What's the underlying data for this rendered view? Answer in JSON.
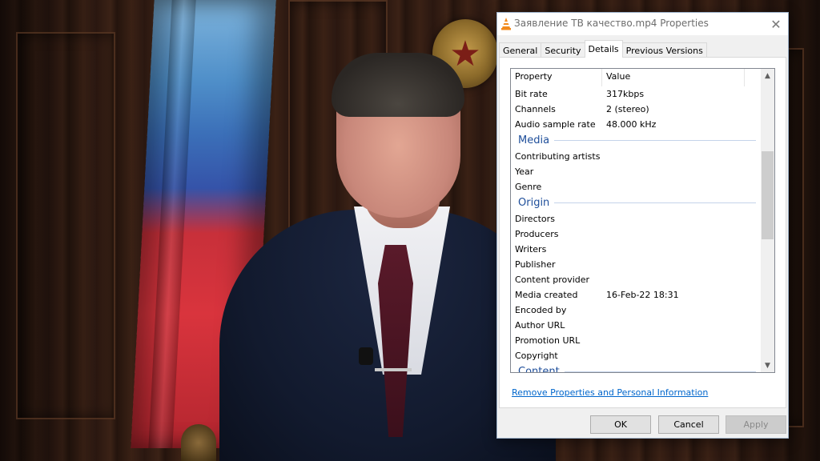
{
  "window": {
    "title": "Заявление ТВ качество.mp4 Properties",
    "icon": "vlc-cone-icon",
    "close_glyph": "✕"
  },
  "tabs": [
    {
      "label": "General",
      "active": false
    },
    {
      "label": "Security",
      "active": false
    },
    {
      "label": "Details",
      "active": true
    },
    {
      "label": "Previous Versions",
      "active": false
    }
  ],
  "details": {
    "columns": {
      "property": "Property",
      "value": "Value"
    },
    "top_rows": [
      {
        "name": "Bit rate",
        "value": "317kbps"
      },
      {
        "name": "Channels",
        "value": "2 (stereo)"
      },
      {
        "name": "Audio sample rate",
        "value": "48.000 kHz"
      }
    ],
    "groups": {
      "media": {
        "label": "Media",
        "rows": [
          {
            "name": "Contributing artists",
            "value": ""
          },
          {
            "name": "Year",
            "value": ""
          },
          {
            "name": "Genre",
            "value": ""
          }
        ]
      },
      "origin": {
        "label": "Origin",
        "rows": [
          {
            "name": "Directors",
            "value": ""
          },
          {
            "name": "Producers",
            "value": ""
          },
          {
            "name": "Writers",
            "value": ""
          },
          {
            "name": "Publisher",
            "value": ""
          },
          {
            "name": "Content provider",
            "value": ""
          },
          {
            "name": "Media created",
            "value": "16-Feb-22 18:31"
          },
          {
            "name": "Encoded by",
            "value": ""
          },
          {
            "name": "Author URL",
            "value": ""
          },
          {
            "name": "Promotion URL",
            "value": ""
          },
          {
            "name": "Copyright",
            "value": ""
          }
        ]
      }
    },
    "partial_group": {
      "label": "Content"
    }
  },
  "link": {
    "remove": "Remove Properties and Personal Information"
  },
  "buttons": {
    "ok": "OK",
    "cancel": "Cancel",
    "apply": "Apply"
  },
  "scroll": {
    "up_glyph": "▲",
    "down_glyph": "▼"
  },
  "colors": {
    "group_label": "#1e4e9a",
    "link": "#0066cc",
    "flag_blue": "#3553a9",
    "flag_red": "#d9343d"
  }
}
